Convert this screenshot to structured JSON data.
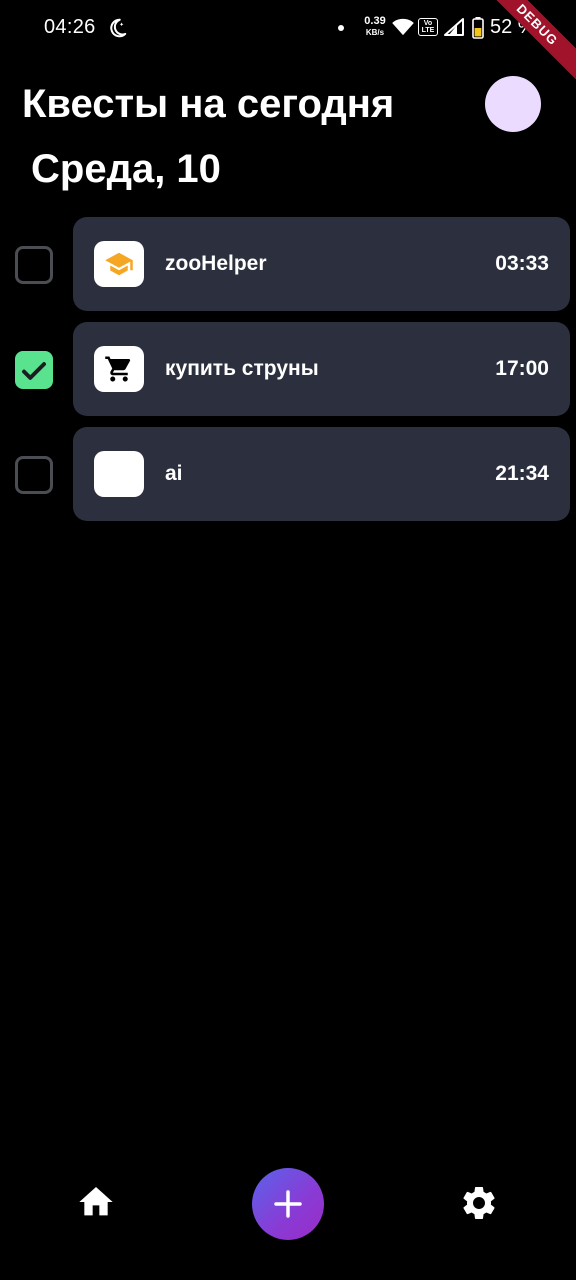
{
  "status_bar": {
    "time": "04:26",
    "net_speed_value": "0.39",
    "net_speed_unit": "KB/s",
    "volte_top": "Vo",
    "volte_bottom": "LTE",
    "battery": "52 %",
    "icons": [
      "moon-icon",
      "wifi-icon",
      "volte-icon",
      "signal-icon",
      "battery-icon"
    ]
  },
  "debug_banner": "DEBUG",
  "header": {
    "title": "Квесты на сегодня",
    "date": "Среда, 10",
    "avatar_color": "#ebdcff"
  },
  "quests": [
    {
      "title": "zooHelper",
      "time": "03:33",
      "done": false,
      "icon": "graduation-cap-icon",
      "icon_color": "#f5a623"
    },
    {
      "title": "купить струны",
      "time": "17:00",
      "done": true,
      "icon": "shopping-cart-icon",
      "icon_color": "#000000"
    },
    {
      "title": "ai",
      "time": "21:34",
      "done": false,
      "icon": "",
      "icon_color": ""
    }
  ],
  "bottom_nav": {
    "items": [
      "home-icon",
      "add-icon",
      "settings-icon"
    ]
  },
  "colors": {
    "background": "#000000",
    "card": "#2c2f3d",
    "check_done": "#5ae38f",
    "check_border": "#4a4d52",
    "fab_start": "#5a63ea",
    "fab_end": "#9a2cc8",
    "debug_ribbon": "#a0132a"
  }
}
